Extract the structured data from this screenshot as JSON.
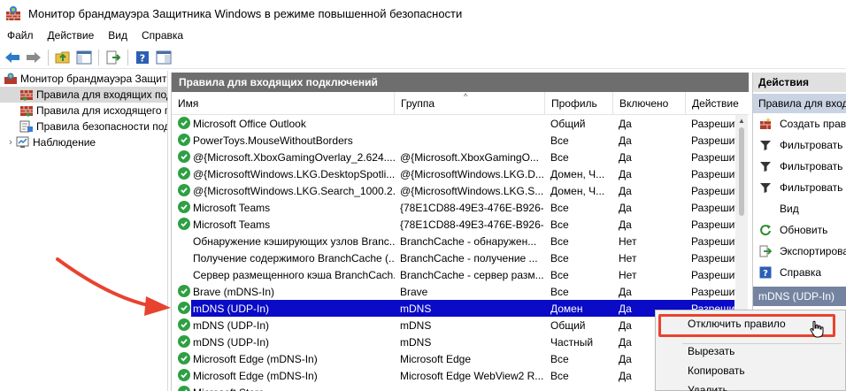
{
  "window": {
    "title": "Монитор брандмауэра Защитника Windows в режиме повышенной безопасности"
  },
  "menubar": {
    "items": [
      "Файл",
      "Действие",
      "Вид",
      "Справка"
    ]
  },
  "tree": {
    "items": [
      {
        "label": "Монитор брандмауэра Защитника Windows"
      },
      {
        "label": "Правила для входящих подключений"
      },
      {
        "label": "Правила для исходящего подключения"
      },
      {
        "label": "Правила безопасности подключений"
      },
      {
        "label": "Наблюдение"
      }
    ]
  },
  "center": {
    "header": "Правила для входящих подключений",
    "columns": [
      "Имя",
      "Группа",
      "Профиль",
      "Включено",
      "Действие"
    ],
    "rows": [
      {
        "name": "Microsoft Office Outlook",
        "group": "",
        "profile": "Общий",
        "enabled": "Да",
        "action": "Разрешить",
        "icon": true,
        "selected": false
      },
      {
        "name": "PowerToys.MouseWithoutBorders",
        "group": "",
        "profile": "Все",
        "enabled": "Да",
        "action": "Разрешить",
        "icon": true,
        "selected": false
      },
      {
        "name": "@{Microsoft.XboxGamingOverlay_2.624....",
        "group": "@{Microsoft.XboxGamingO...",
        "profile": "Все",
        "enabled": "Да",
        "action": "Разрешить",
        "icon": true,
        "selected": false
      },
      {
        "name": "@{MicrosoftWindows.LKG.DesktopSpotli...",
        "group": "@{MicrosoftWindows.LKG.D...",
        "profile": "Домен, Ч...",
        "enabled": "Да",
        "action": "Разрешить",
        "icon": true,
        "selected": false
      },
      {
        "name": "@{MicrosoftWindows.LKG.Search_1000.2...",
        "group": "@{MicrosoftWindows.LKG.S...",
        "profile": "Домен, Ч...",
        "enabled": "Да",
        "action": "Разрешить",
        "icon": true,
        "selected": false
      },
      {
        "name": "Microsoft Teams",
        "group": "{78E1CD88-49E3-476E-B926-...",
        "profile": "Все",
        "enabled": "Да",
        "action": "Разрешить",
        "icon": true,
        "selected": false
      },
      {
        "name": "Microsoft Teams",
        "group": "{78E1CD88-49E3-476E-B926-...",
        "profile": "Все",
        "enabled": "Да",
        "action": "Разрешить",
        "icon": true,
        "selected": false
      },
      {
        "name": "Обнаружение кэширующих узлов Branc...",
        "group": "BranchCache - обнаружен...",
        "profile": "Все",
        "enabled": "Нет",
        "action": "Разрешить",
        "icon": false,
        "selected": false
      },
      {
        "name": "Получение содержимого BranchCache (...",
        "group": "BranchCache - получение ...",
        "profile": "Все",
        "enabled": "Нет",
        "action": "Разрешить",
        "icon": false,
        "selected": false
      },
      {
        "name": "Сервер размещенного кэша BranchCach...",
        "group": "BranchCache - сервер разм...",
        "profile": "Все",
        "enabled": "Нет",
        "action": "Разрешить",
        "icon": false,
        "selected": false
      },
      {
        "name": "Brave (mDNS-In)",
        "group": "Brave",
        "profile": "Все",
        "enabled": "Да",
        "action": "Разрешить",
        "icon": true,
        "selected": false
      },
      {
        "name": "mDNS (UDP-In)",
        "group": "mDNS",
        "profile": "Домен",
        "enabled": "Да",
        "action": "Разрешить",
        "icon": true,
        "selected": true
      },
      {
        "name": "mDNS (UDP-In)",
        "group": "mDNS",
        "profile": "Общий",
        "enabled": "Да",
        "action": "Разрешить",
        "icon": true,
        "selected": false
      },
      {
        "name": "mDNS (UDP-In)",
        "group": "mDNS",
        "profile": "Частный",
        "enabled": "Да",
        "action": "Разрешить",
        "icon": true,
        "selected": false
      },
      {
        "name": "Microsoft Edge (mDNS-In)",
        "group": "Microsoft Edge",
        "profile": "Все",
        "enabled": "Да",
        "action": "Разрешить",
        "icon": true,
        "selected": false
      },
      {
        "name": "Microsoft Edge (mDNS-In)",
        "group": "Microsoft Edge WebView2 R...",
        "profile": "Все",
        "enabled": "Да",
        "action": "Разрешить",
        "icon": true,
        "selected": false
      },
      {
        "name": "Microsoft Store",
        "group": "",
        "profile": "",
        "enabled": "",
        "action": "",
        "icon": true,
        "selected": false
      }
    ]
  },
  "actions": {
    "header": "Действия",
    "section_main": "Правила для входящих подключений",
    "items": [
      {
        "label": "Создать правило...",
        "icon": "new-rule-icon"
      },
      {
        "label": "Фильтровать по профилю",
        "icon": "filter-icon"
      },
      {
        "label": "Фильтровать по состоянию",
        "icon": "filter-icon"
      },
      {
        "label": "Фильтровать по группе",
        "icon": "filter-icon"
      },
      {
        "label": "Вид",
        "icon": ""
      },
      {
        "label": "Обновить",
        "icon": "refresh-icon"
      },
      {
        "label": "Экспортировать список...",
        "icon": "export-icon"
      },
      {
        "label": "Справка",
        "icon": "help-icon"
      }
    ],
    "section_selected": "mDNS (UDP-In)"
  },
  "context_menu": {
    "items": [
      "Отключить правило",
      "Вырезать",
      "Копировать",
      "Удалить"
    ]
  },
  "colors": {
    "accent_selection": "#0a0ac7",
    "highlight_box": "#e8432f",
    "annotation_arrow": "#e8432f",
    "enabled_check": "#2ea043"
  }
}
